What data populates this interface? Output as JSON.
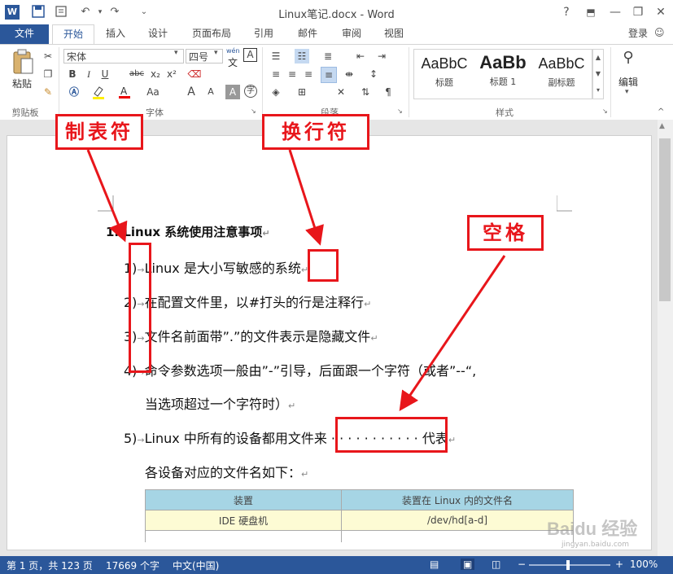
{
  "titlebar": {
    "title": "Linux笔记.docx - Word",
    "help": "?",
    "minimize": "—",
    "restore": "❐",
    "close": "✕"
  },
  "tabs": {
    "file": "文件",
    "home": "开始",
    "insert": "插入",
    "design": "设计",
    "layout": "页面布局",
    "references": "引用",
    "mailings": "邮件",
    "review": "审阅",
    "view": "视图",
    "login": "登录"
  },
  "ribbon": {
    "paste_label": "粘贴",
    "font_name": "宋体",
    "font_size": "四号",
    "wen": "wén",
    "wen_char": "文",
    "A_box": "A",
    "bold": "B",
    "italic": "I",
    "underline": "U",
    "strike": "abc",
    "subscript": "x₂",
    "superscript": "x²",
    "case": "Aa",
    "group_clipboard": "剪贴板",
    "group_font": "字体",
    "group_paragraph": "段落",
    "group_styles": "样式",
    "styles": [
      {
        "sample": "AaBbC",
        "name": "标题"
      },
      {
        "sample": "AaBb",
        "name": "标题 1"
      },
      {
        "sample": "AaBbC",
        "name": "副标题"
      }
    ],
    "edit_label": "编辑"
  },
  "document": {
    "heading": "1. Linux 系统使用注意事项",
    "items": [
      {
        "num": "1)",
        "text": "Linux 是大小写敏感的系统"
      },
      {
        "num": "2)",
        "text": "在配置文件里，以#打头的行是注释行"
      },
      {
        "num": "3)",
        "text": "文件名前面带”.”的文件表示是隐藏文件"
      },
      {
        "num": "4)",
        "text": "命令参数选项一般由”-”引导，后面跟一个字符（或者”--“,"
      },
      {
        "num": "",
        "text": "当选项超过一个字符时）"
      },
      {
        "num": "5)",
        "text": "Linux 中所有的设备都用文件来 · · · · · · · · · · · 代表"
      },
      {
        "num": "",
        "text": "各设备对应的文件名如下："
      }
    ],
    "table": {
      "headers": [
        "装置",
        "装置在 Linux 内的文件名"
      ],
      "rows": [
        [
          "IDE 硬盘机",
          "/dev/hd[a-d]"
        ]
      ]
    }
  },
  "annotations": {
    "tab_char": "制表符",
    "line_break": "换行符",
    "space": "空格"
  },
  "statusbar": {
    "page": "第 1 页，共 123 页",
    "words": "17669 个字",
    "language": "中文(中国)",
    "zoom": "100%"
  },
  "watermark": "Baidu 经验",
  "watermark_url": "jingyan.baidu.com"
}
